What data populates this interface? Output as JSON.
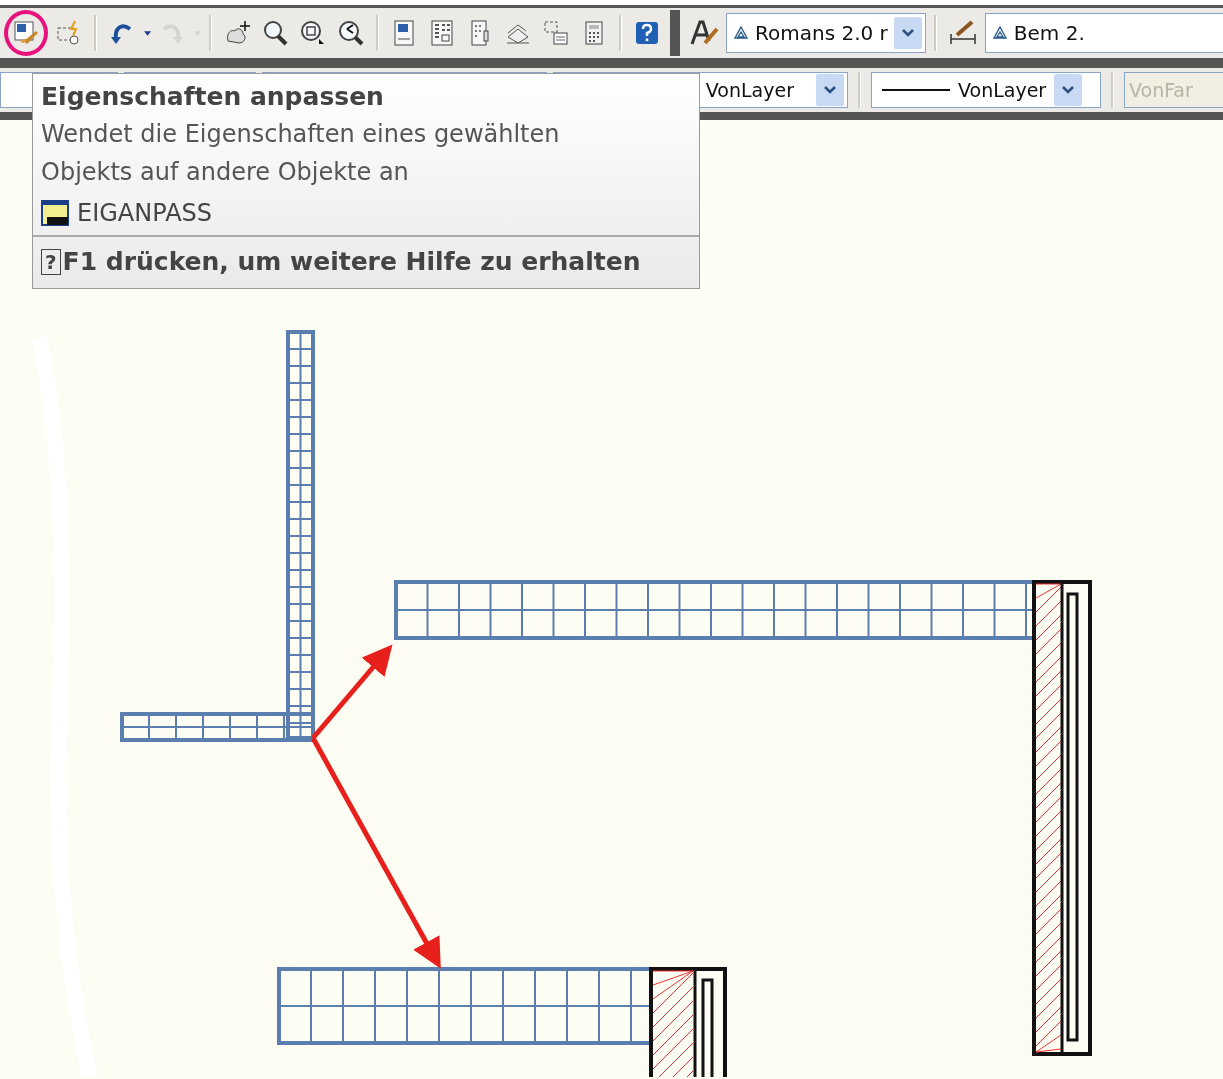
{
  "standard_toolbar": {
    "buttons": [
      {
        "highlighted": true,
        "disabled": false
      },
      {
        "highlighted": false,
        "disabled": false
      },
      {
        "highlighted": false,
        "disabled": false
      },
      {
        "highlighted": false,
        "disabled": false
      },
      {
        "highlighted": false,
        "disabled": true
      },
      {
        "highlighted": false,
        "disabled": true
      },
      {
        "highlighted": false,
        "disabled": false
      },
      {
        "highlighted": false,
        "disabled": false
      },
      {
        "highlighted": false,
        "disabled": false
      },
      {
        "highlighted": false,
        "disabled": false
      },
      {
        "highlighted": false,
        "disabled": false
      },
      {
        "highlighted": false,
        "disabled": false
      },
      {
        "highlighted": false,
        "disabled": false
      },
      {
        "highlighted": false,
        "disabled": false
      },
      {
        "highlighted": false,
        "disabled": false
      },
      {
        "highlighted": false,
        "disabled": false
      },
      {
        "highlighted": false,
        "disabled": false
      }
    ]
  },
  "styles_toolbar": {
    "text_style": {
      "value": "Romans 2.0 r"
    },
    "dim_style": {
      "value": "Bem 2."
    }
  },
  "properties_toolbar": {
    "layer_color": {
      "value": "VonLayer"
    },
    "linetype": {
      "value": "VonLayer"
    },
    "lineweight": {
      "value": "VonFar",
      "disabled": true
    }
  },
  "tooltip": {
    "title": "Eigenschaften anpassen",
    "description": "Wendet die Eigenschaften eines gewählten Objekts auf andere Objekte an",
    "command": "EIGANPASS",
    "help_glyph": "?",
    "help_text": "F1 drücken, um weitere Hilfe zu erhalten"
  }
}
